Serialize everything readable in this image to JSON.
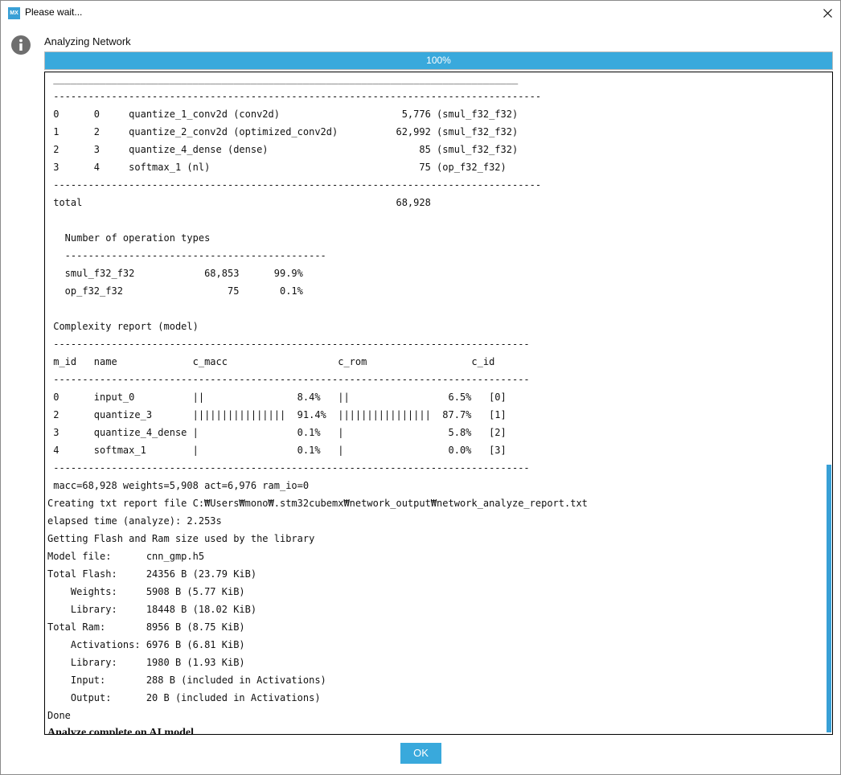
{
  "window": {
    "title": "Please wait...",
    "app_icon_text": "MX",
    "close_icon": "close-icon"
  },
  "status": {
    "label": "Analyzing Network",
    "info_icon": "info-icon"
  },
  "progress": {
    "percent": 100,
    "label": "100%"
  },
  "colors": {
    "accent": "#39a9dc",
    "border": "#8a8a8a"
  },
  "console": {
    "lines": [
      " ________________________________________________________________________________",
      " ------------------------------------------------------------------------------------",
      " 0      0     quantize_1_conv2d (conv2d)                     5,776 (smul_f32_f32)",
      " 1      2     quantize_2_conv2d (optimized_conv2d)          62,992 (smul_f32_f32)",
      " 2      3     quantize_4_dense (dense)                          85 (smul_f32_f32)",
      " 3      4     softmax_1 (nl)                                    75 (op_f32_f32)",
      " ------------------------------------------------------------------------------------",
      " total                                                      68,928",
      "",
      "   Number of operation types",
      "   ---------------------------------------------",
      "   smul_f32_f32            68,853      99.9%",
      "   op_f32_f32                  75       0.1%",
      "",
      " Complexity report (model)",
      " ----------------------------------------------------------------------------------",
      " m_id   name             c_macc                   c_rom                  c_id",
      " ----------------------------------------------------------------------------------",
      " 0      input_0          ||                8.4%   ||                 6.5%   [0]",
      " 2      quantize_3       ||||||||||||||||  91.4%  ||||||||||||||||  87.7%   [1]",
      " 3      quantize_4_dense |                 0.1%   |                  5.8%   [2]",
      " 4      softmax_1        |                 0.1%   |                  0.0%   [3]",
      " ----------------------------------------------------------------------------------",
      " macc=68,928 weights=5,908 act=6,976 ram_io=0",
      "Creating txt report file C:₩Users₩mono₩.stm32cubemx₩network_output₩network_analyze_report.txt",
      "elapsed time (analyze): 2.253s",
      "Getting Flash and Ram size used by the library",
      "Model file:      cnn_gmp.h5",
      "Total Flash:     24356 B (23.79 KiB)",
      "    Weights:     5908 B (5.77 KiB)",
      "    Library:     18448 B (18.02 KiB)",
      "Total Ram:       8956 B (8.75 KiB)",
      "    Activations: 6976 B (6.81 KiB)",
      "    Library:     1980 B (1.93 KiB)",
      "    Input:       288 B (included in Activations)",
      "    Output:      20 B (included in Activations)",
      "Done"
    ],
    "final_message": "Analyze complete on AI model"
  },
  "buttons": {
    "ok_label": "OK"
  }
}
